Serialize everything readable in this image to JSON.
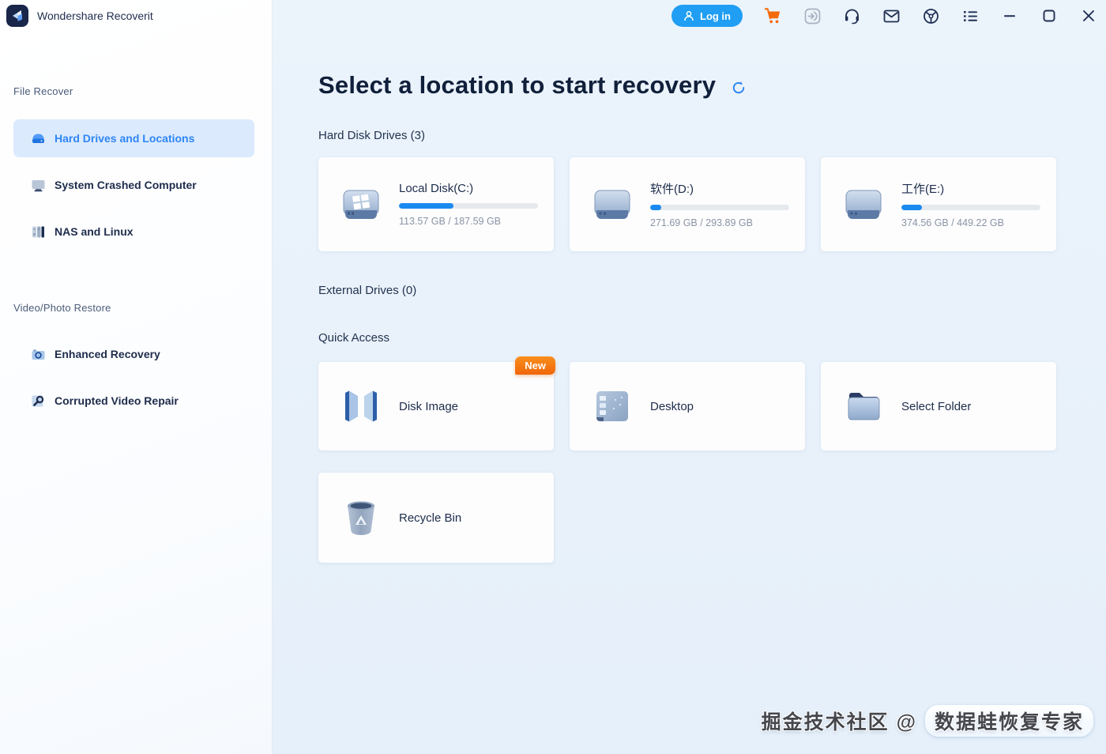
{
  "window": {
    "brand": "Wondershare Recoverit",
    "topbar": {
      "login_label": "Log in",
      "icons": [
        "user-icon",
        "cart-icon",
        "activation-icon",
        "headset-icon",
        "mail-icon",
        "help-icon",
        "menu-list-icon",
        "minimize-icon",
        "maximize-icon",
        "close-icon"
      ]
    }
  },
  "sidebar": {
    "file_recover": {
      "label": "File Recover",
      "items": [
        {
          "label": "Hard Drives and Locations",
          "icon": "hard-drive-icon",
          "selected": true
        },
        {
          "label": "System Crashed Computer",
          "icon": "crashed-computer-icon",
          "selected": false
        },
        {
          "label": "NAS and Linux",
          "icon": "nas-linux-icon",
          "selected": false
        }
      ]
    },
    "video_photo_restore": {
      "label": "Video/Photo Restore",
      "items": [
        {
          "label": "Enhanced Recovery",
          "icon": "camera-icon",
          "selected": false
        },
        {
          "label": "Corrupted Video Repair",
          "icon": "video-repair-icon",
          "selected": false
        }
      ]
    }
  },
  "main": {
    "title": "Select a location to start recovery",
    "refresh_icon": "refresh-icon",
    "sections": {
      "hard_disk_drives": "Hard Disk Drives (3)",
      "external_drives": "External Drives (0)",
      "quick_access": "Quick Access"
    },
    "drives": [
      {
        "name": "Local Disk(C:)",
        "capacity": "113.57 GB / 187.59 GB",
        "used_percent": 39,
        "icon": "windows-disk-icon"
      },
      {
        "name": "软件(D:)",
        "capacity": "271.69 GB / 293.89 GB",
        "used_percent": 8,
        "icon": "disk-icon"
      },
      {
        "name": "工作(E:)",
        "capacity": "374.56 GB / 449.22 GB",
        "used_percent": 15,
        "icon": "disk-icon"
      }
    ],
    "quick_access": [
      {
        "label": "Disk Image",
        "icon": "disk-image-icon",
        "badge": "New"
      },
      {
        "label": "Desktop",
        "icon": "desktop-icon"
      },
      {
        "label": "Select Folder",
        "icon": "folder-icon"
      },
      {
        "label": "Recycle Bin",
        "icon": "recycle-bin-icon"
      }
    ]
  },
  "watermark": {
    "left": "掘金技术社区 @",
    "right": "数据蛙恢复专家"
  },
  "colors": {
    "accent_blue": "#2e86f5",
    "progress_blue": "#1b8af0",
    "login_button_blue": "#1f9ef3",
    "cart_orange": "#f46a0a",
    "badge_orange": "#f0660a",
    "selected_item_bg": "#dceafd",
    "main_background": "#e9f2fb",
    "title_text": "#101f3a",
    "muted_text": "#8a94a4"
  }
}
